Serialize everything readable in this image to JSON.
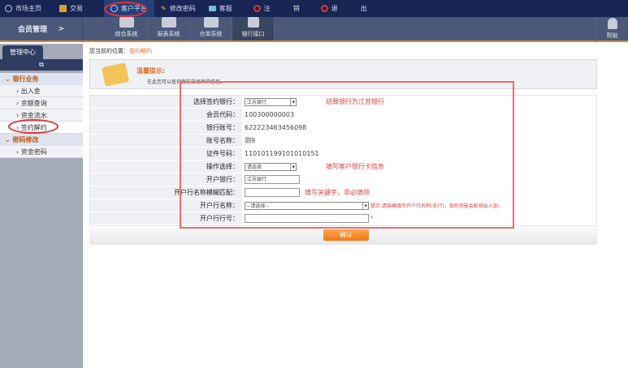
{
  "topnav": [
    {
      "label": "市场主页",
      "icon": "globe-icon"
    },
    {
      "label": "交易",
      "icon": "trophy-icon"
    },
    {
      "label": "客户平台",
      "icon": "globe-icon",
      "active": true
    },
    {
      "label": "修改密码",
      "icon": "pen-icon"
    },
    {
      "label": "客服",
      "icon": "monitor-icon"
    },
    {
      "label": "注　销",
      "icon": "power-icon"
    },
    {
      "label": "退　出",
      "icon": "power-icon"
    }
  ],
  "subbar": {
    "title": "会员管理",
    "arrow": ">",
    "systems": [
      "综合系统",
      "报表系统",
      "仓单系统",
      "银行接口"
    ],
    "help": "帮助"
  },
  "sidebar": {
    "tab": "管理中心",
    "sections": [
      {
        "label": "银行业务",
        "items": [
          "出入金",
          "余额查询",
          "资金流水",
          "签约解约"
        ]
      },
      {
        "label": "密码修改",
        "items": [
          "资金密码"
        ]
      }
    ]
  },
  "breadcrumb": {
    "prefix": "您当前的位置：",
    "current": "签约解约"
  },
  "tip": {
    "title": "温馨提示:",
    "text": "在此您可以查询您在交易所的信息。"
  },
  "form": {
    "bank_label": "选择签约银行：",
    "bank_value": "江苏银行",
    "member_label": "会员代码：",
    "member_value": "100300000003",
    "account_label": "银行账号：",
    "account_value": "622223463456098",
    "name_label": "账号名称：",
    "name_value": "测9",
    "id_label": "证件号码：",
    "id_value": "110101199101010151",
    "op_label": "操作选择：",
    "op_value": "请选择",
    "openbank_label": "开户银行：",
    "openbank_value": "江苏银行",
    "fuzzy_label": "开户行名称模糊匹配：",
    "fuzzy_value": "",
    "branch_label": "开户行名称：",
    "branch_value": "--请选择--",
    "branchno_label": "开户行行号：",
    "branchno_value": "",
    "required": "*",
    "branch_hint": "提示:请准确填写开户行名称(支行)，否则可能会影响出入金。",
    "confirm": "确认"
  },
  "annotations": {
    "bank": "结算银行为江苏银行",
    "card": "填写客户银行卡信息",
    "keyword": "填写关键字，非必填项"
  },
  "colors": {
    "topbar": "#172554",
    "subbar": "#4b587a",
    "accent": "#e0702a",
    "annotation": "#e83c3c"
  }
}
